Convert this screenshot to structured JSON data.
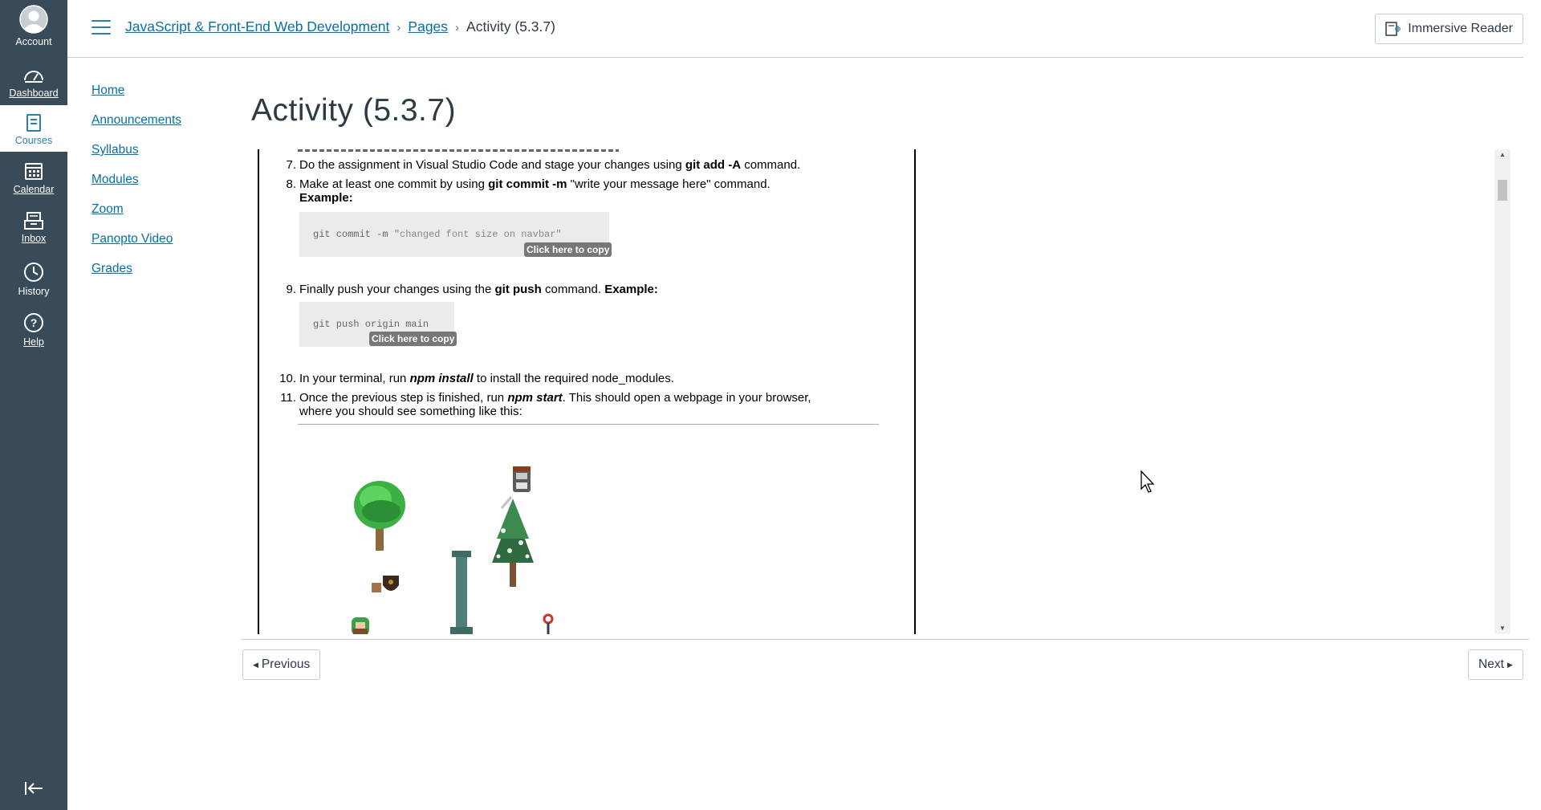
{
  "global_nav": {
    "account": "Account",
    "dashboard": "Dashboard",
    "courses": "Courses",
    "calendar": "Calendar",
    "inbox": "Inbox",
    "history": "History",
    "help": "Help"
  },
  "breadcrumb": {
    "course": "JavaScript & Front-End Web Development",
    "pages": "Pages",
    "current": "Activity (5.3.7)"
  },
  "header": {
    "immersive_reader": "Immersive Reader"
  },
  "course_nav": [
    "Home",
    "Announcements",
    "Syllabus",
    "Modules",
    "Zoom",
    "Panopto Video",
    "Grades"
  ],
  "page_title": "Activity (5.3.7)",
  "content": {
    "step7": {
      "num": "7.",
      "a": "Do the assignment in Visual Studio Code and stage your changes using ",
      "b": "git add -A",
      "c": " command."
    },
    "step8": {
      "num": "8.",
      "a": "Make at least one commit by using ",
      "b": "git commit -m",
      "c": " \"write your message here\" command.",
      "example": "Example:"
    },
    "code1": {
      "cmd": "git commit -m ",
      "str": "\"changed font size on navbar\""
    },
    "step9": {
      "num": "9.",
      "a": "Finally push your changes using the ",
      "b": "git push",
      "c": " command. ",
      "example": "Example:"
    },
    "code2": {
      "cmd": "git push origin main"
    },
    "copy_label": "Click here to copy",
    "step10": {
      "num": "10.",
      "a": "In your terminal, run ",
      "b": "npm install",
      "c": " to install the required node_modules."
    },
    "step11": {
      "num": "11.",
      "a": "Once the previous step is finished, run ",
      "b": "npm start",
      "c": ". This should open a webpage in your browser, where you should see something like this:"
    }
  },
  "footer": {
    "previous": "Previous",
    "next": "Next"
  },
  "colors": {
    "nav_bg": "#394b58",
    "link": "#0770a3",
    "text": "#2d3b45"
  }
}
